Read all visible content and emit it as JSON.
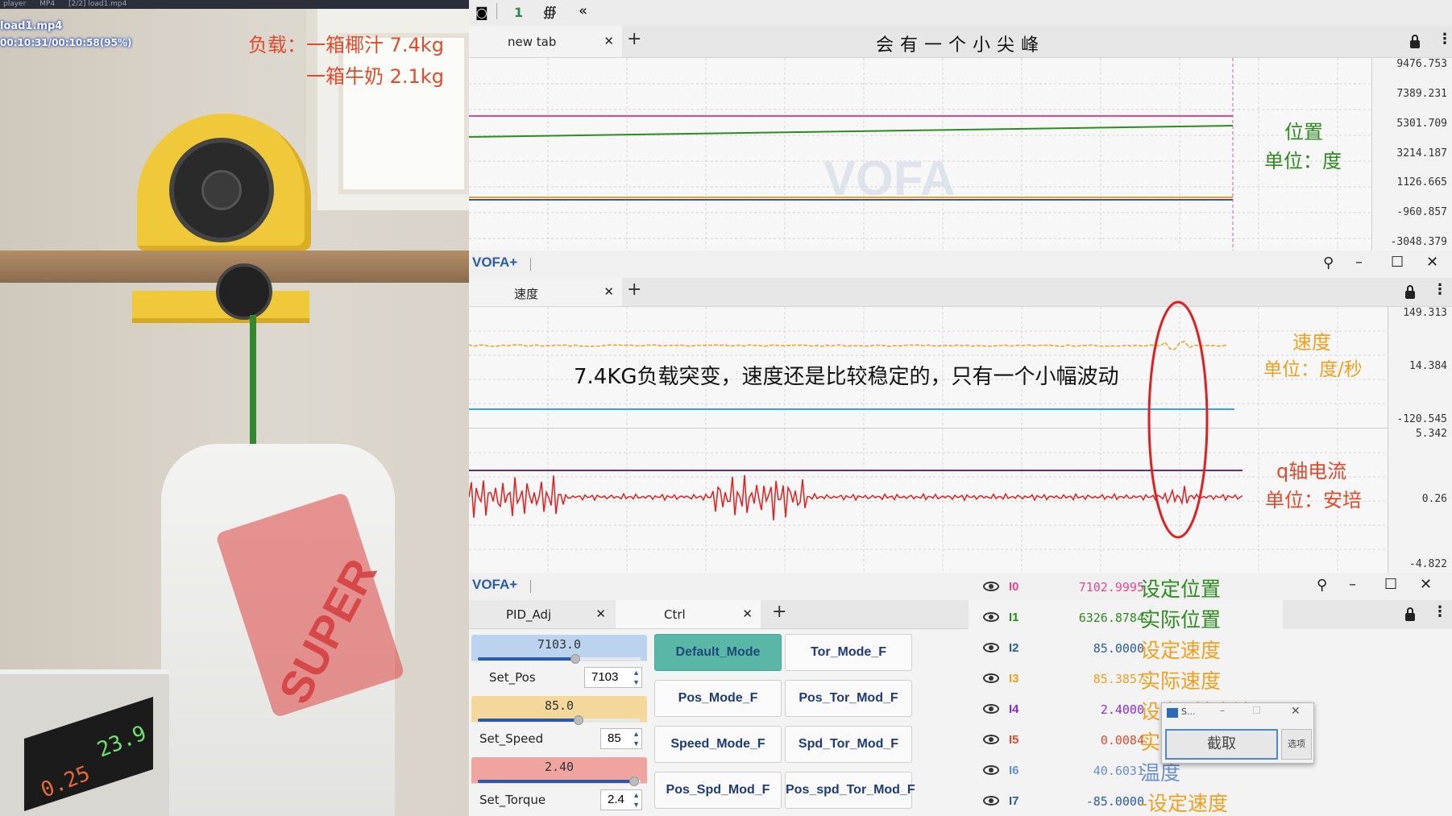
{
  "player": {
    "title_parts": [
      "player",
      "MP4",
      "[2/2] load1.mp4"
    ],
    "file_overlay": "load1.mp4",
    "time_overlay": "00:10:31/00:10:58(95%)"
  },
  "video": {
    "load_line1": "负载：一箱椰汁 7.4kg",
    "load_line2": "一箱牛奶 2.1kg",
    "psu_voltage": "23.9",
    "psu_current": "0.25"
  },
  "toolbar_icons": [
    "camera-icon",
    "one-icon",
    "fingerprint-icon",
    "rewind-icon"
  ],
  "panel1": {
    "tab_label": "new tab",
    "header_note": "会有一个小尖峰",
    "y_ticks": [
      "9476.753",
      "7389.231",
      "5301.709",
      "3214.187",
      "1126.665",
      "-960.857",
      "-3048.379"
    ],
    "annotation_line1": "位置",
    "annotation_line2": "单位：度",
    "watermark": "VOFA"
  },
  "panel2": {
    "app_title": "VOFA+",
    "tab_label": "速度",
    "y_ticks_top": [
      "149.313",
      "14.384",
      "-120.545"
    ],
    "y_ticks_bottom": [
      "5.342",
      "0.26",
      "-4.822"
    ],
    "speed_line1": "速度",
    "speed_line2": "单位：度/秒",
    "current_line1": "q轴电流",
    "current_line2": "单位：安培",
    "center_note": "7.4KG负载突变，速度还是比较稳定的，只有一个小幅波动"
  },
  "panel3": {
    "app_title": "VOFA+",
    "tabs": [
      {
        "label": "PID_Adj"
      },
      {
        "label": "Ctrl"
      }
    ],
    "sliders": [
      {
        "value_text": "7103.0",
        "label": "Set_Pos",
        "spin": "7103",
        "color": "#bcd3f0",
        "fraction": 0.6
      },
      {
        "value_text": "85.0",
        "label": "Set_Speed",
        "spin": "85",
        "color": "#f4d79a",
        "fraction": 0.62
      },
      {
        "value_text": "2.40",
        "label": "Set_Torque",
        "spin": "2.4",
        "color": "#f0a4a0",
        "fraction": 0.96
      }
    ],
    "buttons": [
      [
        "Default_Mode",
        "Tor_Mode_F"
      ],
      [
        "Pos_Mode_F",
        "Pos_Tor_Mod_F"
      ],
      [
        "Speed_Mode_F",
        "Spd_Tor_Mod_F"
      ],
      [
        "Pos_Spd_Mod_F",
        "Pos_spd_Tor_Mod_F"
      ]
    ],
    "channels": [
      {
        "name": "I0",
        "value": "7102.9995",
        "desc": "设定位置",
        "color": "#e14a8a",
        "desc_color": "#2e8b1f"
      },
      {
        "name": "I1",
        "value": "6326.8784",
        "desc": "实际位置",
        "color": "#2e8b1f",
        "desc_color": "#2e8b1f"
      },
      {
        "name": "I2",
        "value": "85.0000",
        "desc": "设定速度",
        "color": "#2a5aa8",
        "desc_color": "#f0a020"
      },
      {
        "name": "I3",
        "value": "85.3857",
        "desc": "实际速度",
        "color": "#f0a020",
        "desc_color": "#f0a020"
      },
      {
        "name": "I4",
        "value": "2.4000",
        "desc": "设定q轴电流",
        "color": "#8a2be2",
        "desc_color": "#f0a020"
      },
      {
        "name": "I5",
        "value": "0.0084",
        "desc": "实际q轴电流",
        "color": "#e14a2c",
        "desc_color": "#f0a020"
      },
      {
        "name": "I6",
        "value": "40.6031",
        "desc": "温度",
        "color": "#6a8fd0",
        "desc_color": "#6a8fd0"
      },
      {
        "name": "I7",
        "value": "-85.0000",
        "desc": "-设定速度",
        "color": "#2a5aa8",
        "desc_color": "#f0a020"
      }
    ]
  },
  "dialog": {
    "title": "S...",
    "capture_label": "截取",
    "options_label": "选项"
  },
  "colors": {
    "vofa_blue": "#2a5aa8",
    "pink_series": "#e14a8a",
    "green_series": "#2e8b1f",
    "orange_series": "#f0a020",
    "blue_series": "#3aa0e8",
    "red_series": "#e02020",
    "purple_series": "#6a2a8a",
    "highlight_circle": "#e02020"
  }
}
